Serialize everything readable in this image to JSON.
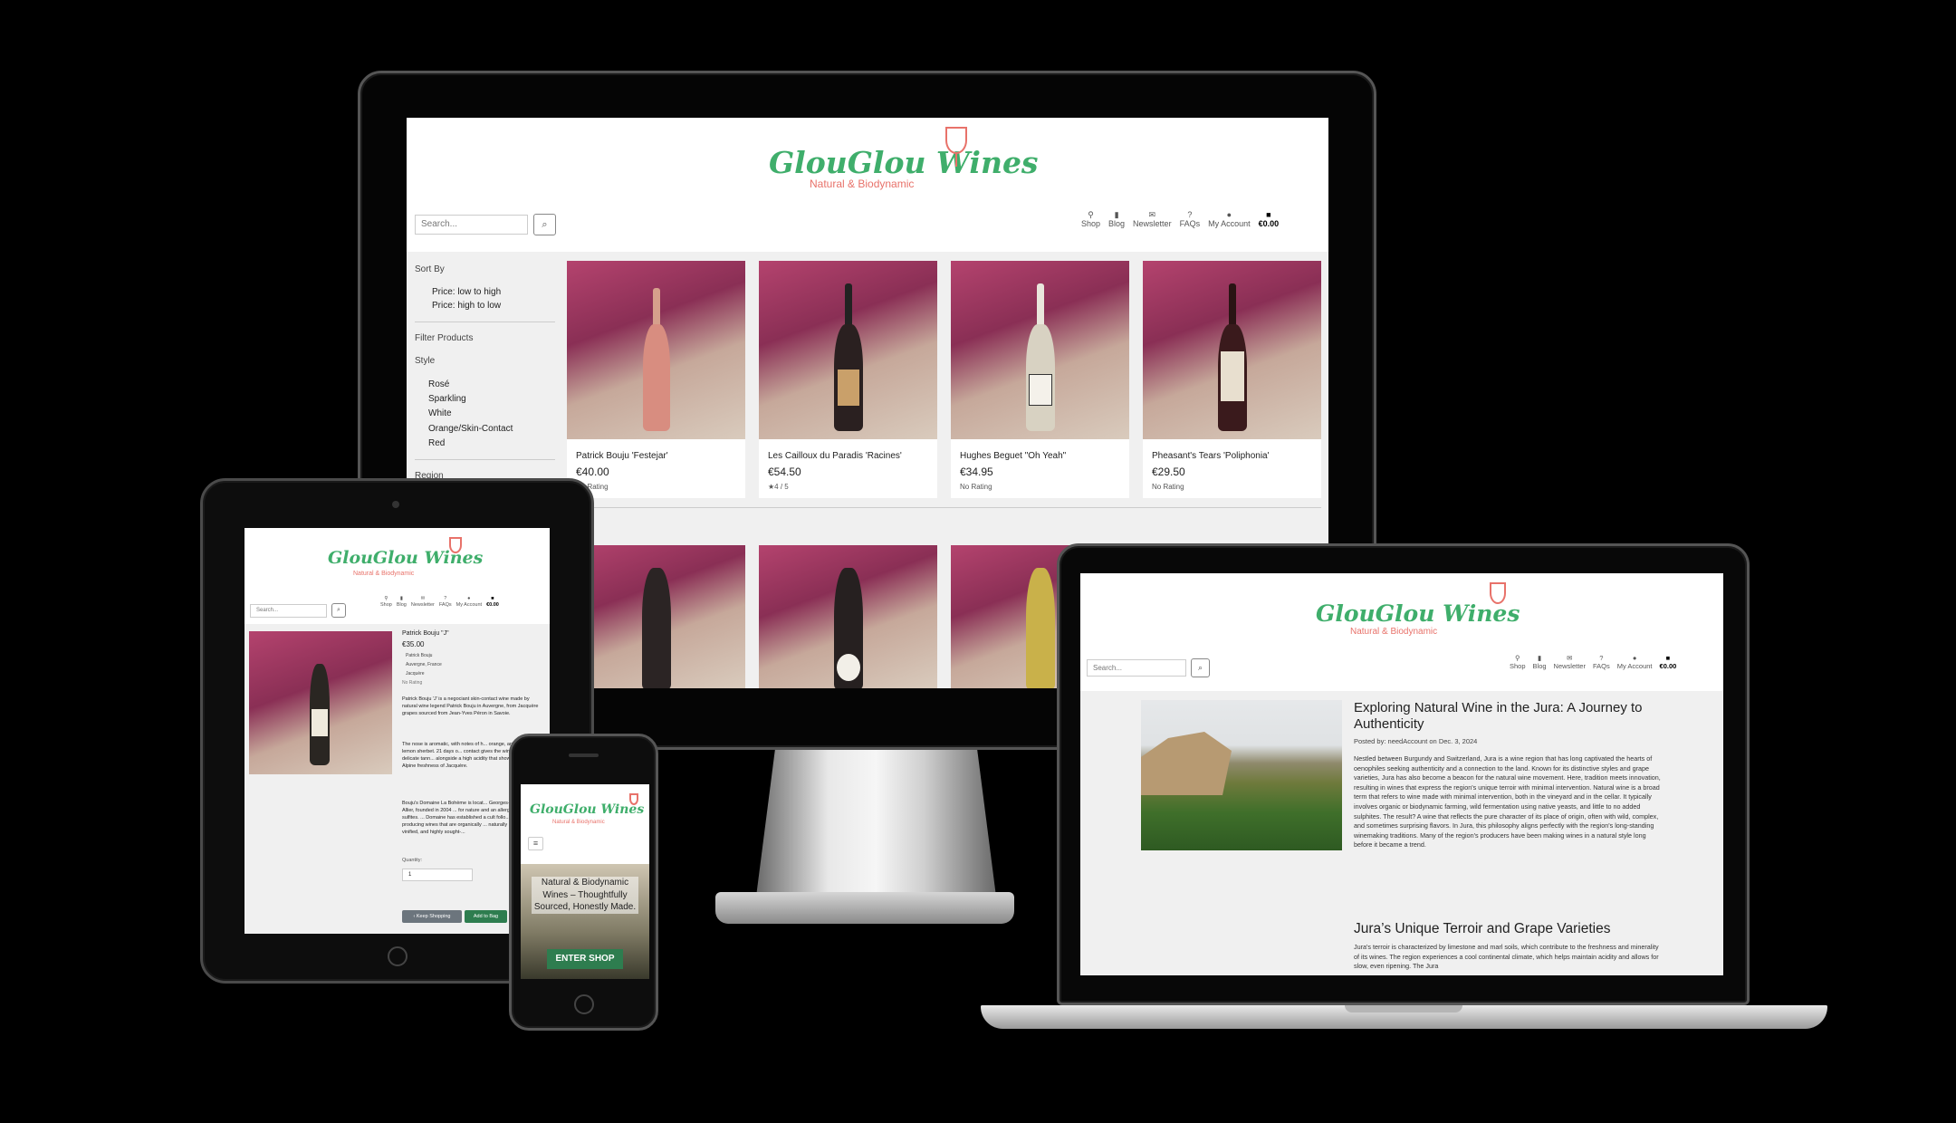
{
  "brand": {
    "name": "GlouGlou Wines",
    "tagline": "Natural & Biodynamic"
  },
  "search": {
    "placeholder": "Search..."
  },
  "nav": [
    {
      "label": "Shop",
      "icon": "wine-bottle-icon"
    },
    {
      "label": "Blog",
      "icon": "book-icon"
    },
    {
      "label": "Newsletter",
      "icon": "envelope-icon"
    },
    {
      "label": "FAQs",
      "icon": "question-icon"
    },
    {
      "label": "My Account",
      "icon": "user-icon"
    },
    {
      "label": "€0.00",
      "icon": "shopping-bag-icon"
    }
  ],
  "sidebar": {
    "sort_title": "Sort By",
    "sort_options": [
      "Price: low to high",
      "Price: high to low"
    ],
    "filter_title": "Filter Products",
    "style_title": "Style",
    "styles": [
      "Rosé",
      "Sparkling",
      "White",
      "Orange/Skin-Contact",
      "Red"
    ],
    "region_title": "Region"
  },
  "products": [
    {
      "name": "Patrick Bouju 'Festejar'",
      "price": "€40.00",
      "rating": "No Rating"
    },
    {
      "name": "Les Cailloux du Paradis 'Racines'",
      "price": "€54.50",
      "rating": "4 / 5"
    },
    {
      "name": "Hughes Beguet \"Oh Yeah\"",
      "price": "€34.95",
      "rating": "No Rating"
    },
    {
      "name": "Pheasant's Tears 'Poliphonia'",
      "price": "€29.50",
      "rating": "No Rating"
    }
  ],
  "detail": {
    "name": "Patrick Bouju \"J\"",
    "price": "€35.00",
    "producer": "Patrick Bouju",
    "region": "Auvergne, France",
    "grape": "Jacquère",
    "rating": "No Rating",
    "para1": "Patrick Bouju 'J' is a negociant skin-contact wine made by natural wine legend Patrick Bouju in Auvergne, from Jacquère grapes sourced from Jean-Yves Péron in Savoie.",
    "para2": "The nose is aromatic, with notes of h... orange, and lemon sherbet. 21 days o... contact gives the wine delicate tann... alongside a high acidity that showca... Alpine freshness of Jacquère.",
    "para3": "Bouju's Domaine La Bohème is locat... Georges-sur-Allier, founded in 2004 ... for nature and an allergy to sulfites. ... Domaine has established a cult follo... producing wines that are organically ... naturally vinified, and highly sought-...",
    "quantity_label": "Quantity:",
    "quantity_value": "1",
    "keep_shopping": "Keep Shopping",
    "add_to_bag": "Add to Bag"
  },
  "phone": {
    "hero_text": "Natural & Biodynamic Wines – Thoughtfully Sourced, Honestly Made.",
    "cta": "ENTER SHOP"
  },
  "blog": {
    "title": "Exploring Natural Wine in the Jura: A Journey to Authenticity",
    "meta": "Posted by: needAccount on Dec. 3, 2024",
    "body": "Nestled between Burgundy and Switzerland, Jura is a wine region that has long captivated the hearts of oenophiles seeking authenticity and a connection to the land. Known for its distinctive styles and grape varieties, Jura has also become a beacon for the natural wine movement. Here, tradition meets innovation, resulting in wines that express the region's unique terroir with minimal intervention. Natural wine is a broad term that refers to wine made with minimal intervention, both in the vineyard and in the cellar. It typically involves organic or biodynamic farming, wild fermentation using native yeasts, and little to no added sulphites. The result? A wine that reflects the pure character of its place of origin, often with wild, complex, and sometimes surprising flavors. In Jura, this philosophy aligns perfectly with the region's long-standing winemaking traditions. Many of the region's producers have been making wines in a natural style long before it became a trend.",
    "h2": "Jura’s Unique Terroir and Grape Varieties",
    "body2": "Jura's terroir is characterized by limestone and marl soils, which contribute to the freshness and minerality of its wines. The region experiences a cool continental climate, which helps maintain acidity and allows for slow, even ripening. The Jura"
  }
}
